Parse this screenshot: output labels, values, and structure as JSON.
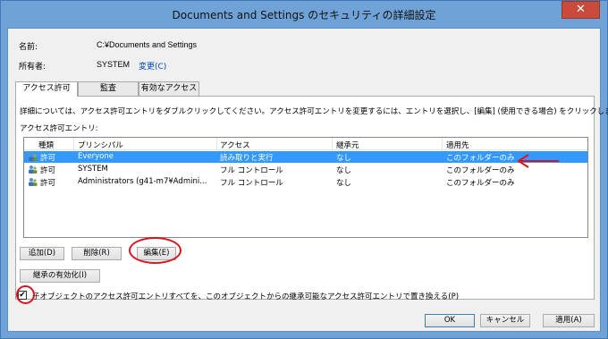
{
  "window": {
    "title": "Documents and Settings のセキュリティの詳細設定",
    "close_glyph": "✕"
  },
  "info": {
    "name_label": "名前:",
    "name_value": "C:¥Documents and Settings",
    "owner_label": "所有者:",
    "owner_value": "SYSTEM",
    "change_link": "変更(C)"
  },
  "tabs": [
    {
      "label": "アクセス許可"
    },
    {
      "label": "監査"
    },
    {
      "label": "有効なアクセス"
    }
  ],
  "panel": {
    "description": "詳細については、アクセス許可エントリをダブルクリックしてください。アクセス許可エントリを変更するには、エントリを選択し、[編集] (使用できる場合) をクリックします。",
    "entries_label": "アクセス許可エントリ:"
  },
  "list": {
    "headers": [
      "種類",
      "プリンシパル",
      "アクセス",
      "継承元",
      "適用先"
    ],
    "rows": [
      {
        "type": "許可",
        "principal": "Everyone",
        "access": "読み取りと実行",
        "inherited": "なし",
        "applies": "このフォルダーのみ"
      },
      {
        "type": "許可",
        "principal": "SYSTEM",
        "access": "フル コントロール",
        "inherited": "なし",
        "applies": "このフォルダーのみ"
      },
      {
        "type": "許可",
        "principal": "Administrators (g41-m7¥Admini...",
        "access": "フル コントロール",
        "inherited": "なし",
        "applies": "このフォルダーのみ"
      }
    ]
  },
  "buttons": {
    "add": "追加(D)",
    "remove": "削除(R)",
    "edit": "編集(E)",
    "enable_inheritance": "継承の有効化(I)",
    "ok": "OK",
    "cancel": "キャンセル",
    "apply": "適用(A)"
  },
  "replace_checkbox": {
    "checked": true,
    "check_glyph": "✔",
    "label": "子オブジェクトのアクセス許可エントリすべてを、このオブジェクトからの継承可能なアクセス許可エントリで置き換える(P)"
  },
  "colors": {
    "selection": "#3399ff",
    "annotation": "#d9141e",
    "link": "#0046c8"
  }
}
